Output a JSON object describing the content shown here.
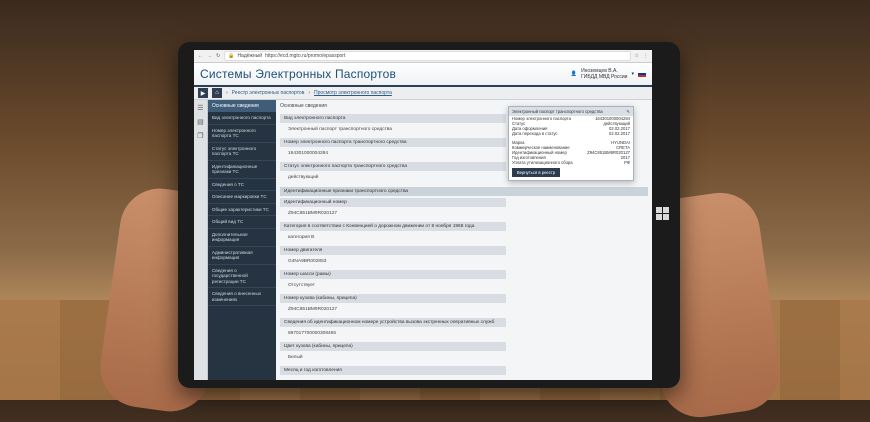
{
  "browser": {
    "secure_label": "Надёжный",
    "url": "https://ecd.mgto.ru/promo/epassport"
  },
  "app": {
    "title": "Системы Электронных Паспортов",
    "user_name": "Иноземцев В.А.",
    "user_org": "ГИБДД МВД России"
  },
  "breadcrumb": {
    "home_sep": "›",
    "items": [
      "Реестр электронных паспортов",
      "Просмотр электронного паспорта"
    ]
  },
  "sidebar": {
    "header": "Основные сведения",
    "items": [
      "Вид электронного паспорта",
      "Номер электронного паспорта ТС",
      "Статус электронного паспорта ТС",
      "Идентификационные признаки ТС",
      "Сведения о ТС",
      "Описание маркировки ТС",
      "Общие характеристики ТС",
      "Общий вид ТС",
      "Дополнительная информация",
      "Административная информация",
      "Сведения о государственной регистрации ТС",
      "Сведения о внесенных изменениях"
    ]
  },
  "content": {
    "title": "Основные сведения",
    "fields": [
      {
        "label": "Вид электронного паспорта",
        "value": "Электронный паспорт транспортного средства"
      },
      {
        "label": "Номер электронного паспорта транспортного средства",
        "value": "164301000004284"
      },
      {
        "label": "Статус электронного паспорта транспортного средства",
        "value": "действующий"
      }
    ],
    "section": "Идентификационные признаки транспортного средства",
    "id_fields": [
      {
        "label": "Идентификационный номер",
        "value": "Z94C851BM9R020127"
      },
      {
        "label": "Категория в соответствии с Конвенцией о дорожном движении от 8 ноября 1968 года",
        "value": "категория B"
      },
      {
        "label": "Номер двигателя",
        "value": "G4NA9BR002853"
      },
      {
        "label": "Номер шасси (рамы)",
        "value": "Отсутствует"
      },
      {
        "label": "Номер кузова (кабины, прицепа)",
        "value": "Z94C851BM9R020127"
      },
      {
        "label": "Сведения об идентификационном номере устройства вызова экстренных оперативных служб",
        "value": "897017700000308465"
      },
      {
        "label": "Цвет кузова (кабины, прицепа)",
        "value": "Белый"
      },
      {
        "label": "Месяц и год изготовления",
        "value": ""
      }
    ]
  },
  "popup": {
    "title": "Электронный паспорт транспортного средства",
    "lines": [
      {
        "k": "Номер электронного паспорта",
        "v": "164301000004284"
      },
      {
        "k": "Статус",
        "v": "действующий"
      },
      {
        "k": "Дата оформления",
        "v": "02.02.2017"
      },
      {
        "k": "Дата перехода в статус",
        "v": "02.02.2017"
      }
    ],
    "lines2": [
      {
        "k": "Марка",
        "v": "HYUNDAI"
      },
      {
        "k": "Коммерческое наименование",
        "v": "CRETA"
      },
      {
        "k": "Идентификационный номер",
        "v": "Z94C851BM9R020127"
      },
      {
        "k": "Год изготовления",
        "v": "2017"
      },
      {
        "k": "Уплата утилизационного сбора",
        "v": "РФ"
      }
    ],
    "button": "Вернуться в реестр"
  }
}
